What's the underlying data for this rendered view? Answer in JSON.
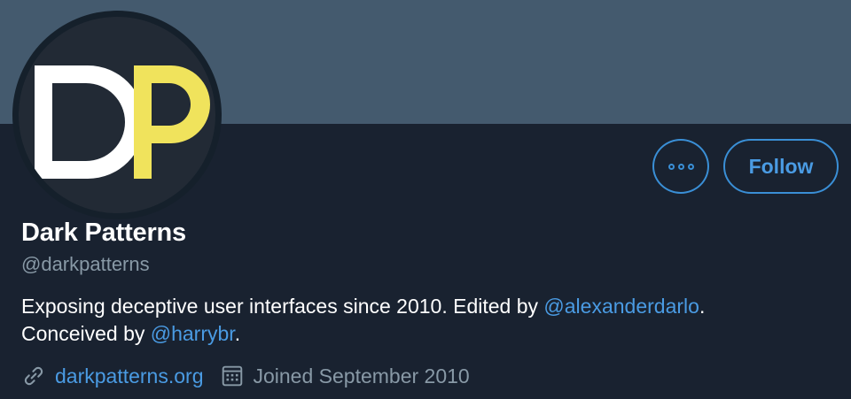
{
  "profile": {
    "name": "Dark Patterns",
    "handle": "@darkpatterns",
    "avatar_letters": [
      "D",
      "P"
    ],
    "bio": {
      "part1": "Exposing deceptive user interfaces since 2010. Edited by ",
      "mention1": "@alexanderdarlo",
      "part2": ".",
      "part3": "Conceived by ",
      "mention2": "@harrybr",
      "part4": "."
    },
    "website": "darkpatterns.org",
    "joined": "Joined September 2010"
  },
  "actions": {
    "more_icon": "more-icon",
    "follow_label": "Follow"
  },
  "colors": {
    "banner": "#445a6e",
    "background": "#192230",
    "accent": "#4a9be3",
    "avatar_d": "#ffffff",
    "avatar_p": "#f0e35c"
  }
}
